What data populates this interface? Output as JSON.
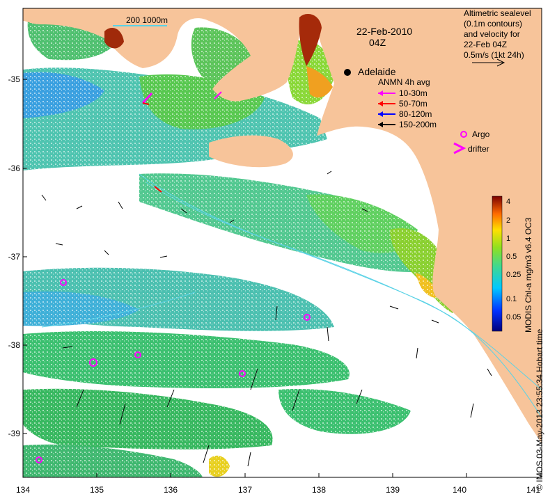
{
  "map": {
    "date": "22-Feb-2010",
    "time": "04Z",
    "scale_bar": "200  1000m",
    "place": "Adelaide",
    "top_right_note": [
      "Altimetric sealevel",
      "(0.1m contours)",
      "and velocity for",
      "22-Feb 04Z",
      "0.5m/s (1kt 24h)"
    ],
    "legend": {
      "title": "ANMN 4h avg",
      "items": [
        {
          "label": "10-30m",
          "color": "#ff00ff"
        },
        {
          "label": "50-70m",
          "color": "#ff0000"
        },
        {
          "label": "80-120m",
          "color": "#0000ff"
        },
        {
          "label": "150-200m",
          "color": "#000000"
        }
      ],
      "argo": "Argo",
      "drifter": "drifter"
    },
    "colorbar": {
      "title": "MODIS Chl-a mg/m3 v6.4 OC3",
      "ticks": [
        "4",
        "2",
        "1",
        "0.5",
        "0.25",
        "0.1",
        "0.05"
      ],
      "scale": "log"
    },
    "footer": "© IMOS 03-May-2013 23:55:34 Hobart time",
    "x_ticks": [
      "134",
      "135",
      "136",
      "137",
      "138",
      "139",
      "140",
      "141"
    ],
    "y_ticks": [
      "-35",
      "-36",
      "-37",
      "-38",
      "-39"
    ],
    "colors": {
      "land": "#f7c49a",
      "ocean_blank": "#ffffff",
      "contour": "#5ad2e6"
    }
  }
}
